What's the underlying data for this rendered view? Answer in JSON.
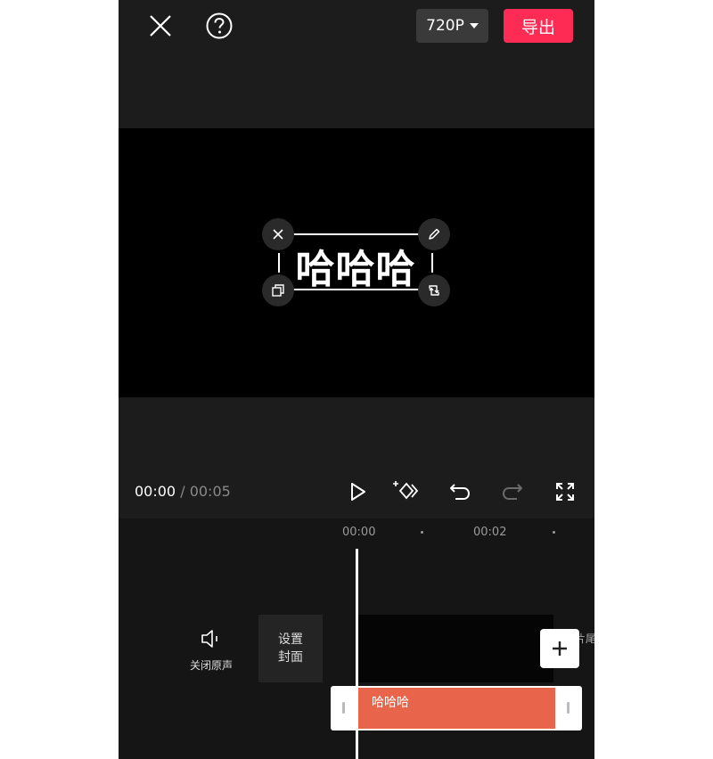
{
  "topbar": {
    "resolution": "720P",
    "export_label": "导出"
  },
  "preview": {
    "overlay_text": "哈哈哈"
  },
  "playback": {
    "current_time": "00:00",
    "separator": "/",
    "total_time": "00:05"
  },
  "timeline": {
    "ticks": [
      "00:00",
      "00:02"
    ],
    "mute_label": "关闭原声",
    "cover_label_line1": "设置",
    "cover_label_line2": "封面",
    "tail_label": "片尾",
    "text_clip_label": "哈哈哈"
  },
  "colors": {
    "accent": "#fe2c55",
    "text_clip": "#e8644a",
    "background": "#1c1c1c"
  }
}
